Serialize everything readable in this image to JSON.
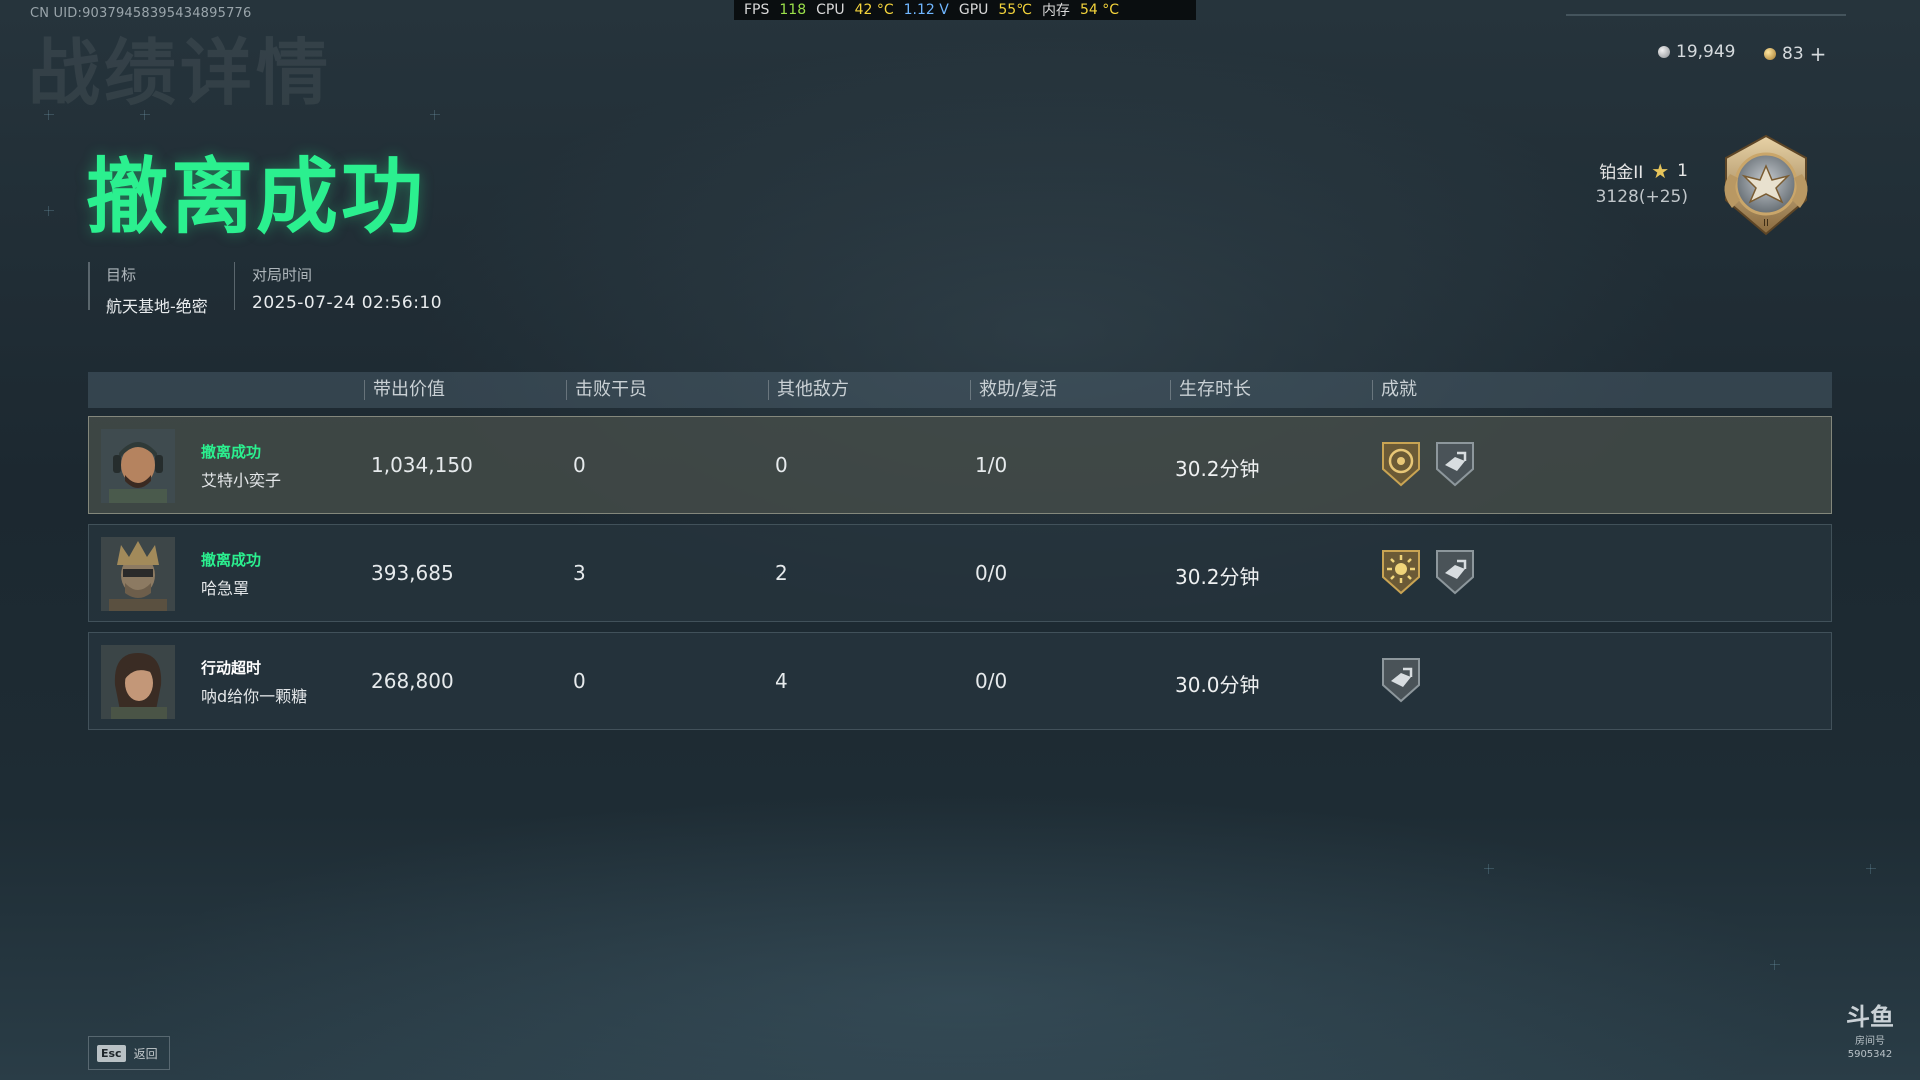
{
  "header": {
    "uid": "CN UID:9037945839543489577​6",
    "bg_title": "战绩详情"
  },
  "perf": {
    "fps_label": "FPS",
    "fps": "118",
    "cpu_label": "CPU",
    "cpu_temp": "42 °C",
    "cpu_volt": "1.12 V",
    "gpu_label": "GPU",
    "gpu_temp": "55℃",
    "mem_label": "内存",
    "mem_temp": "54 °C"
  },
  "currency": {
    "silver": "19,949",
    "gold": "83",
    "add": "+"
  },
  "rank": {
    "name": "铂金II",
    "stars": "1",
    "score": "3128(+25)",
    "badge_icon": "platinum-eagle-badge-icon"
  },
  "result": {
    "headline": "撤离成功"
  },
  "meta": {
    "target_label": "目标",
    "target_value": "航天基地-绝密",
    "time_label": "对局时间",
    "time_value": "2025-07-24 02:56:10"
  },
  "table": {
    "headers": [
      "带出价值",
      "击败干员",
      "其他敌方",
      "救助/复活",
      "生存时长",
      "成就"
    ],
    "rows": [
      {
        "status": "撤离成功",
        "status_color": "#2bf08f",
        "name": "艾特小奕子",
        "value": "1,034,150",
        "kills": "0",
        "others": "0",
        "assist": "1/0",
        "duration": "30.2分钟",
        "achievements": [
          "gold-medal-icon",
          "extraction-icon"
        ]
      },
      {
        "status": "撤离成功",
        "status_color": "#2bf08f",
        "name": "哈急罩",
        "value": "393,685",
        "kills": "3",
        "others": "2",
        "assist": "0/0",
        "duration": "30.2分钟",
        "achievements": [
          "sun-medal-icon",
          "extraction-icon"
        ]
      },
      {
        "status": "行动超时",
        "status_color": "#ffffff",
        "name": "呐d给你一颗糖",
        "value": "268,800",
        "kills": "0",
        "others": "4",
        "assist": "0/0",
        "duration": "30.0分钟",
        "achievements": [
          "extraction-icon"
        ]
      }
    ]
  },
  "footer": {
    "esc_key": "Esc",
    "esc_label": "返回",
    "logo": "斗鱼",
    "logo_sub": "房间号",
    "room_id": "5905342"
  },
  "colors": {
    "accent_green": "#2bf08f",
    "medal_gold": "#c9a453"
  }
}
